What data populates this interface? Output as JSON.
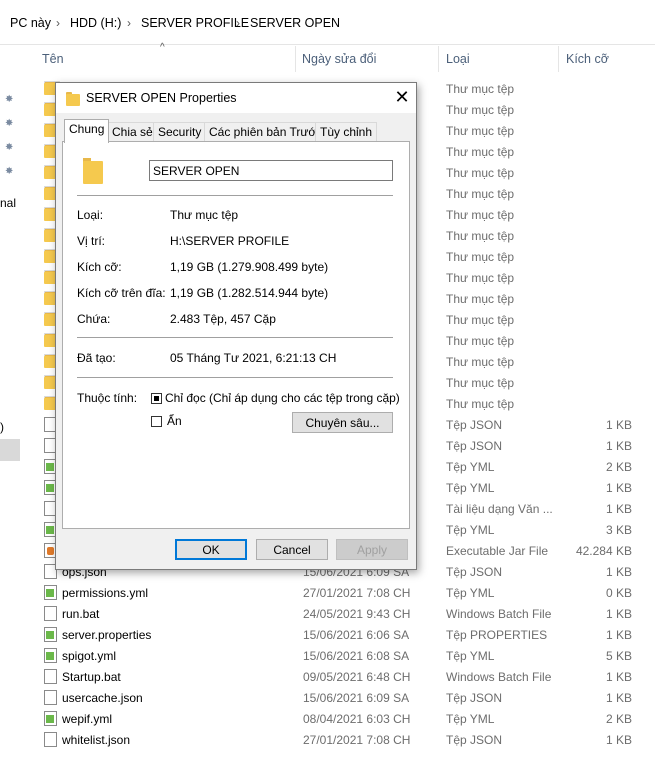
{
  "breadcrumb": [
    "PC này",
    "HDD (H:)",
    "SERVER PROFILE",
    "SERVER OPEN"
  ],
  "columns": {
    "name": "Tên",
    "date": "Ngày sửa đổi",
    "type": "Loại",
    "size": "Kích cỡ"
  },
  "nav_fragments": {
    "nal": "nal",
    "paren": ")"
  },
  "files": [
    {
      "type": "Thư mục tệp",
      "icon": "folder"
    },
    {
      "type": "Thư mục tệp",
      "icon": "folder"
    },
    {
      "type": "Thư mục tệp",
      "icon": "folder"
    },
    {
      "type": "Thư mục tệp",
      "icon": "folder"
    },
    {
      "type": "Thư mục tệp",
      "icon": "folder"
    },
    {
      "type": "Thư mục tệp",
      "icon": "folder"
    },
    {
      "type": "Thư mục tệp",
      "icon": "folder"
    },
    {
      "type": "Thư mục tệp",
      "icon": "folder"
    },
    {
      "type": "Thư mục tệp",
      "icon": "folder"
    },
    {
      "type": "Thư mục tệp",
      "icon": "folder"
    },
    {
      "type": "Thư mục tệp",
      "icon": "folder"
    },
    {
      "type": "Thư mục tệp",
      "icon": "folder"
    },
    {
      "type": "Thư mục tệp",
      "icon": "folder"
    },
    {
      "type": "Thư mục tệp",
      "icon": "folder"
    },
    {
      "type": "Thư mục tệp",
      "icon": "folder"
    },
    {
      "type": "Thư mục tệp",
      "icon": "folder"
    },
    {
      "type": "Tệp JSON",
      "size": "1 KB",
      "icon": "file"
    },
    {
      "type": "Tệp JSON",
      "size": "1 KB",
      "icon": "file"
    },
    {
      "type": "Tệp YML",
      "size": "2 KB",
      "icon": "green"
    },
    {
      "type": "Tệp YML",
      "size": "1 KB",
      "icon": "green"
    },
    {
      "type": "Tài liệu dạng Văn ...",
      "size": "1 KB",
      "icon": "file"
    },
    {
      "type": "Tệp YML",
      "size": "3 KB",
      "icon": "green"
    },
    {
      "type": "Executable Jar File",
      "size": "42.284 KB",
      "icon": "java"
    },
    {
      "name": "ops.json",
      "date": "15/06/2021 6:09 SA",
      "type": "Tệp JSON",
      "size": "1 KB",
      "icon": "file"
    },
    {
      "name": "permissions.yml",
      "date": "27/01/2021 7:08 CH",
      "type": "Tệp YML",
      "size": "0 KB",
      "icon": "green"
    },
    {
      "name": "run.bat",
      "date": "24/05/2021 9:43 CH",
      "type": "Windows Batch File",
      "size": "1 KB",
      "icon": "file"
    },
    {
      "name": "server.properties",
      "date": "15/06/2021 6:06 SA",
      "type": "Tệp PROPERTIES",
      "size": "1 KB",
      "icon": "green"
    },
    {
      "name": "spigot.yml",
      "date": "15/06/2021 6:08 SA",
      "type": "Tệp YML",
      "size": "5 KB",
      "icon": "green"
    },
    {
      "name": "Startup.bat",
      "date": "09/05/2021 6:48 CH",
      "type": "Windows Batch File",
      "size": "1 KB",
      "icon": "file"
    },
    {
      "name": "usercache.json",
      "date": "15/06/2021 6:09 SA",
      "type": "Tệp JSON",
      "size": "1 KB",
      "icon": "file"
    },
    {
      "name": "wepif.yml",
      "date": "08/04/2021 6:03 CH",
      "type": "Tệp YML",
      "size": "2 KB",
      "icon": "green"
    },
    {
      "name": "whitelist.json",
      "date": "27/01/2021 7:08 CH",
      "type": "Tệp JSON",
      "size": "1 KB",
      "icon": "file"
    }
  ],
  "dialog": {
    "title": "SERVER OPEN Properties",
    "tabs": [
      "Chung",
      "Chia sẻ",
      "Security",
      "Các phiên bản Trước",
      "Tùy chỉnh"
    ],
    "name_value": "SERVER OPEN",
    "props": {
      "type_label": "Loại:",
      "type_value": "Thư mục tệp",
      "location_label": "Vị trí:",
      "location_value": "H:\\SERVER PROFILE",
      "size_label": "Kích cỡ:",
      "size_value": "1,19 GB (1.279.908.499 byte)",
      "disk_label": "Kích cỡ trên đĩa:",
      "disk_value": "1,19 GB (1.282.514.944 byte)",
      "contains_label": "Chứa:",
      "contains_value": "2.483 Tệp, 457 Cặp",
      "created_label": "Đã tạo:",
      "created_value": "05 Tháng Tư 2021, 6:21:13 CH",
      "attr_label": "Thuộc tính:",
      "readonly_label": "Chỉ đọc (Chỉ áp dụng cho các tệp trong cặp)",
      "hidden_label": "Ẩn",
      "advanced_button": "Chuyên sâu..."
    },
    "buttons": {
      "ok": "OK",
      "cancel": "Cancel",
      "apply": "Apply"
    }
  }
}
